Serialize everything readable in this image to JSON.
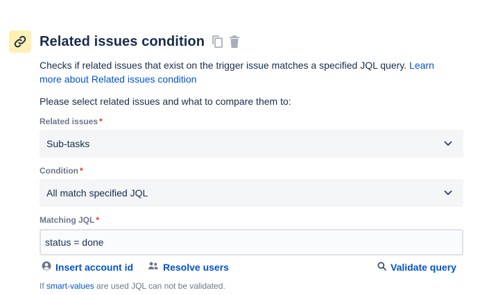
{
  "header": {
    "icon": "link-icon",
    "title": "Related issues condition",
    "copy_icon": "copy-icon",
    "delete_icon": "trash-icon"
  },
  "description": {
    "text": "Checks if related issues that exist on the trigger issue matches a specified JQL query. ",
    "link_text": "Learn more about Related issues condition"
  },
  "prompt": "Please select related issues and what to compare them to:",
  "fields": {
    "related_issues": {
      "label": "Related issues",
      "required_mark": "*",
      "value": "Sub-tasks"
    },
    "condition": {
      "label": "Condition",
      "required_mark": "*",
      "value": "All match specified JQL"
    },
    "matching_jql": {
      "label": "Matching JQL",
      "required_mark": "*",
      "value": "status = done"
    }
  },
  "actions": {
    "insert_account_id": "Insert account id",
    "resolve_users": "Resolve users",
    "validate_query": "Validate query"
  },
  "note": {
    "prefix": "If ",
    "link": "smart-values",
    "suffix": " are used JQL can not be validated."
  },
  "colors": {
    "icon_badge_bg": "#fff0b3",
    "link": "#0052cc",
    "required": "#de350b",
    "label": "#6b778c",
    "select_bg": "#f4f5f7"
  }
}
